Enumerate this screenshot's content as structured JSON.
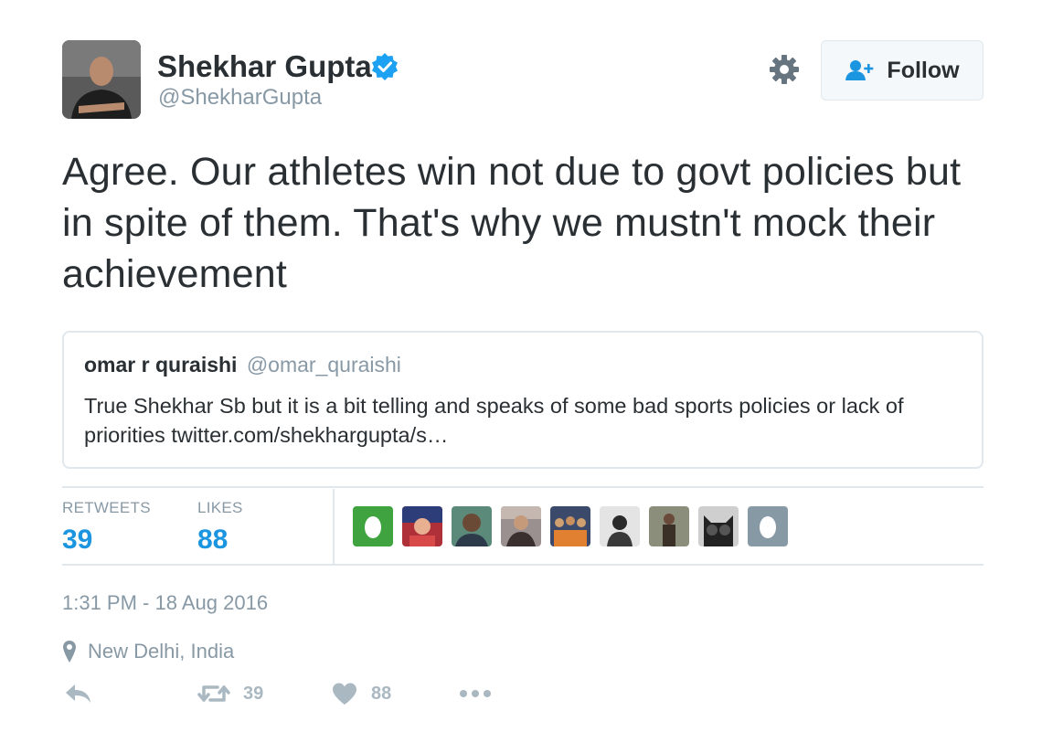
{
  "author": {
    "name": "Shekhar Gupta",
    "handle": "@ShekharGupta"
  },
  "follow_button": {
    "label": "Follow"
  },
  "tweet": {
    "text": "Agree. Our athletes win not due to govt policies but in spite of them. That's why we mustn't mock their achievement"
  },
  "quoted_tweet": {
    "name": "omar r quraishi",
    "handle": "@omar_quraishi",
    "text": "True Shekhar Sb but it is a bit telling and speaks of some bad sports policies or lack of priorities  twitter.com/shekhargupta/s…"
  },
  "stats": {
    "retweets_label": "RETWEETS",
    "retweets_value": "39",
    "likes_label": "LIKES",
    "likes_value": "88"
  },
  "likers": [
    {
      "icon": "egg-avatar-green",
      "color": "#3fa33f"
    },
    {
      "icon": "user-avatar",
      "color": "#b0303a"
    },
    {
      "icon": "user-avatar",
      "color": "#6b5b4a"
    },
    {
      "icon": "user-avatar",
      "color": "#8a7b6e"
    },
    {
      "icon": "user-avatar",
      "color": "#3b4a6a"
    },
    {
      "icon": "user-avatar",
      "color": "#d8d8d8"
    },
    {
      "icon": "user-avatar",
      "color": "#7a7e6a"
    },
    {
      "icon": "cat-avatar",
      "color": "#222222"
    },
    {
      "icon": "egg-avatar-gray",
      "color": "#8899a6"
    }
  ],
  "timestamp": "1:31 PM - 18 Aug 2016",
  "location": "New Delhi, India",
  "actions": {
    "retweet_count": "39",
    "like_count": "88"
  },
  "colors": {
    "accent": "#1b95e0",
    "muted": "#8899a6",
    "border": "#e1e8ed",
    "verified": "#1da1f2"
  }
}
